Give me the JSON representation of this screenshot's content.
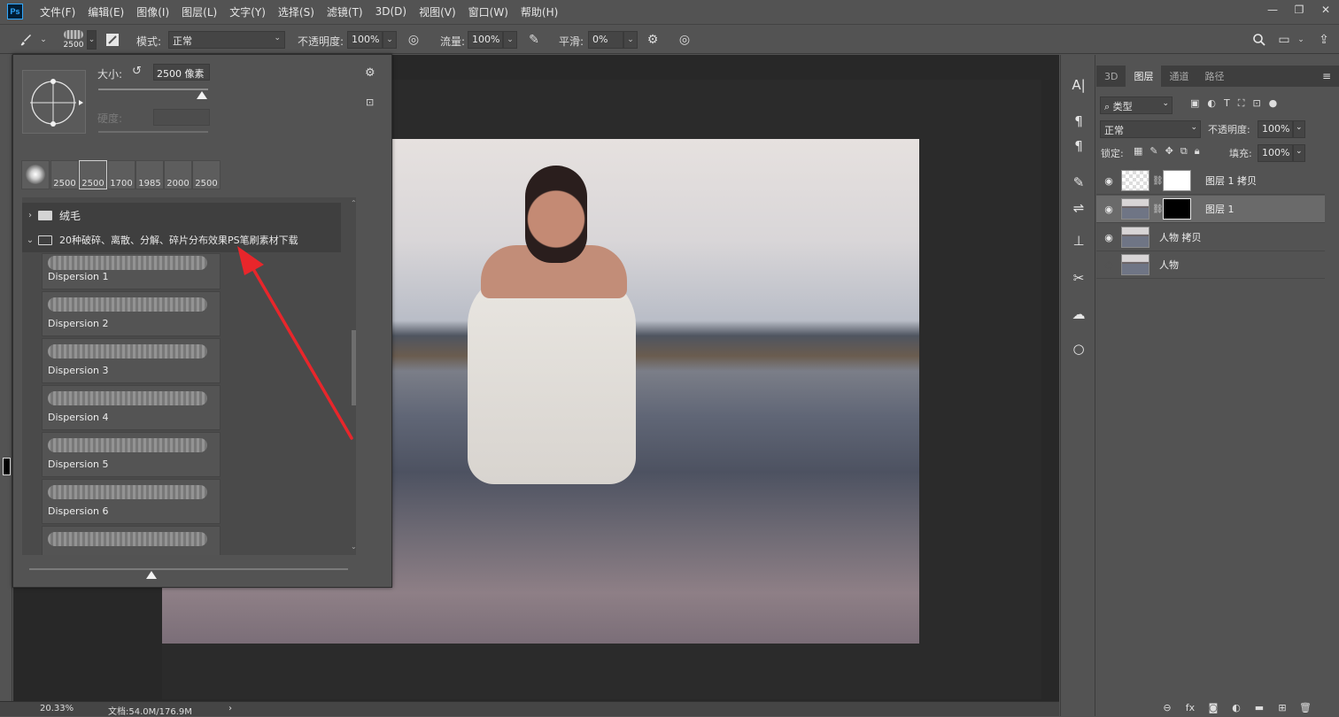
{
  "menubar": {
    "logo": "Ps",
    "items": [
      "文件(F)",
      "编辑(E)",
      "图像(I)",
      "图层(L)",
      "文字(Y)",
      "选择(S)",
      "滤镜(T)",
      "3D(D)",
      "视图(V)",
      "窗口(W)",
      "帮助(H)"
    ]
  },
  "options": {
    "brush_size": "2500",
    "mode_label": "模式:",
    "mode_value": "正常",
    "opacity_label": "不透明度:",
    "opacity_value": "100%",
    "flow_label": "流量:",
    "flow_value": "100%",
    "smooth_label": "平滑:",
    "smooth_value": "0%"
  },
  "brush_popover": {
    "size_label": "大小:",
    "size_value": "2500 像素",
    "hardness_label": "硬度:",
    "recent": [
      "2500",
      "2500",
      "1700",
      "1985",
      "2000",
      "2500"
    ],
    "folders": [
      {
        "name": "绒毛"
      },
      {
        "name": "20种破碎、离散、分解、碎片分布效果PS笔刷素材下载"
      }
    ],
    "brushes": [
      "Dispersion  1",
      "Dispersion  2",
      "Dispersion  3",
      "Dispersion  4",
      "Dispersion  5",
      "Dispersion  6"
    ]
  },
  "status": {
    "zoom": "20.33%",
    "doc": "文档:54.0M/176.9M"
  },
  "layers_panel": {
    "tabs": [
      "3D",
      "图层",
      "通道",
      "路径"
    ],
    "active_tab": "图层",
    "filter": "类型",
    "blend_mode": "正常",
    "opacity_label": "不透明度:",
    "opacity_value": "100%",
    "lock_label": "锁定:",
    "fill_label": "填充:",
    "fill_value": "100%",
    "layers": [
      {
        "name": "图层 1 拷贝",
        "visible": true,
        "mask": "white"
      },
      {
        "name": "图层 1",
        "visible": true,
        "mask": "black",
        "selected": true
      },
      {
        "name": "人物 拷贝",
        "visible": true
      },
      {
        "name": "人物",
        "visible": false
      }
    ]
  },
  "colors": {
    "arrow": "#e8262b",
    "ui_bg": "#535353",
    "canvas_bg": "#282828"
  }
}
